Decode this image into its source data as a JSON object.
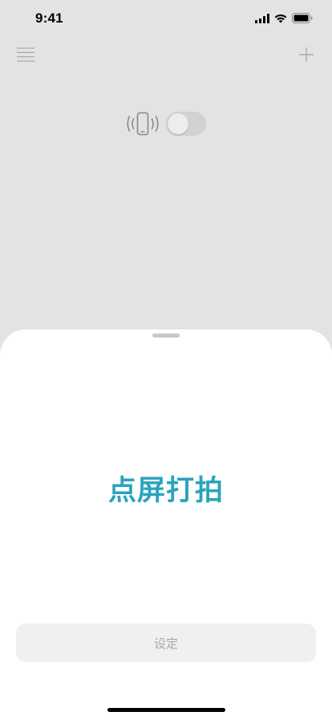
{
  "status_bar": {
    "time": "9:41",
    "icons": [
      "signal-icon",
      "wifi-icon",
      "battery-icon"
    ]
  },
  "top_bar": {
    "left_icon": "menu-icon",
    "right_icon": "plus-icon"
  },
  "vibration": {
    "icon": "phone-vibrate-icon",
    "toggle_on": false
  },
  "sheet": {
    "shoot_label": "点屏打拍",
    "settings_label": "设定"
  },
  "colors": {
    "background": "#e3e3e3",
    "accent": "#2aa3bd",
    "sheet": "#ffffff",
    "button_bg": "#f0f0f0",
    "button_text": "#a8a8a8"
  }
}
